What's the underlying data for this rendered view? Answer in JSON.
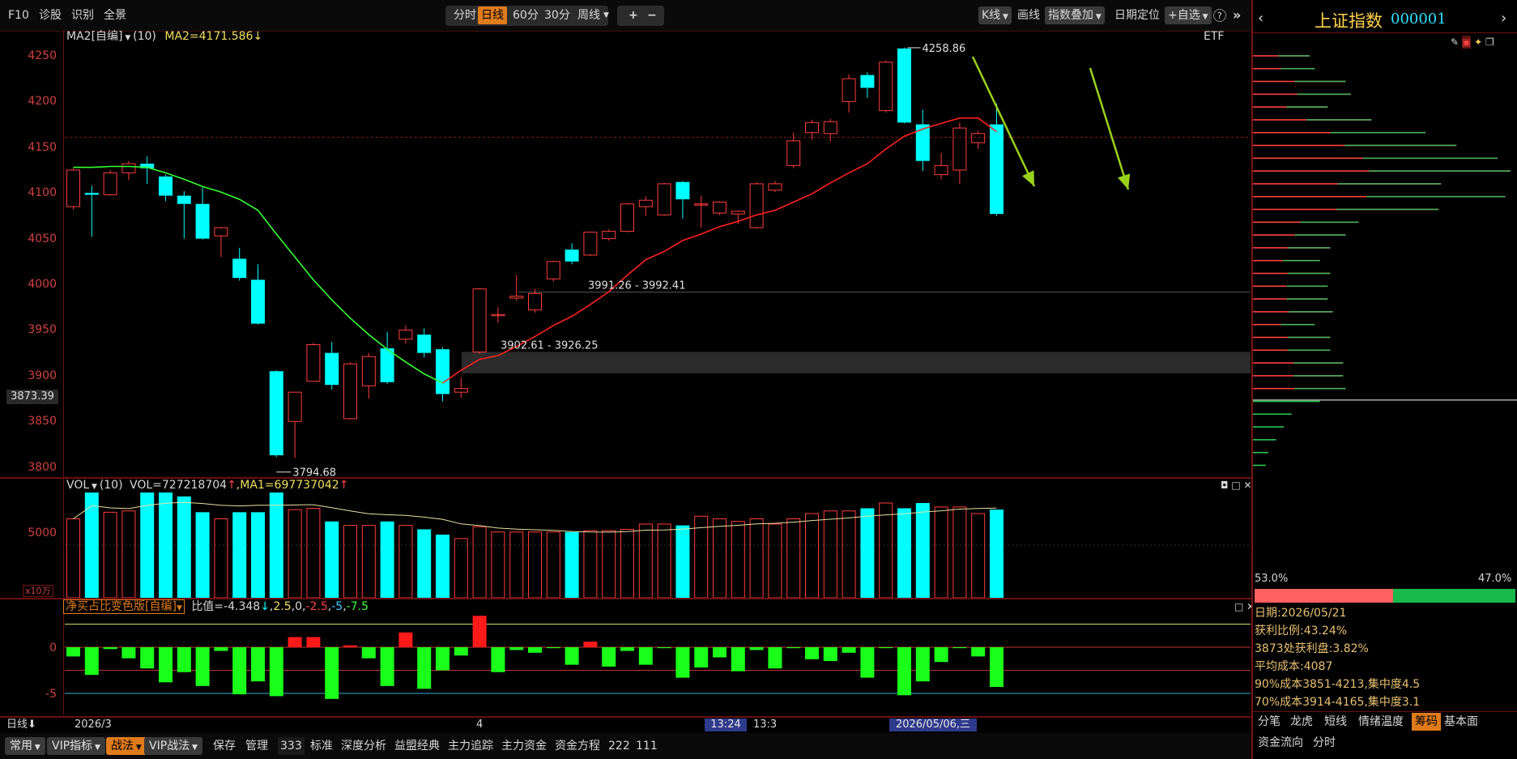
{
  "toolbar": {
    "left": [
      "F10",
      "诊股",
      "识别",
      "全景"
    ],
    "periods": [
      "分时",
      "日线",
      "60分",
      "30分",
      "周线"
    ],
    "period_active": "日线",
    "zoom_in": "+",
    "zoom_out": "−",
    "right": {
      "kline": "K线",
      "draw": "画线",
      "overlay": "指数叠加",
      "date_locate": "日期定位",
      "watchlist": "+自选",
      "help": "?",
      "collapse": "»"
    }
  },
  "main_chart": {
    "indicator_name": "MA2[自编]",
    "param": "(10)",
    "value_text": "MA2=4171.586",
    "etf_label": "ETF",
    "price_labels": [
      "4250",
      "4200",
      "4150",
      "4100",
      "4050",
      "4000",
      "3950",
      "3900",
      "3850",
      "3800"
    ],
    "current_price": "3873.39",
    "annotations": [
      "4258.86",
      "3794.68",
      "3991.26 - 3992.41",
      "3902.61 - 3926.25"
    ]
  },
  "volume_panel": {
    "name": "VOL",
    "param": "(10)",
    "text_vol": "VOL=727218704",
    "text_ma": "MA1=697737042",
    "arrow": "↑",
    "y_label": "5000",
    "unit": "x10万"
  },
  "indicator_panel": {
    "name": "净买占比变色版[自编]",
    "value_label": "比值=-4.348",
    "arrow": "↓",
    "levels": [
      "2.5",
      "0",
      "-2.5",
      "-5",
      "-7.5"
    ],
    "y_labels": [
      "0",
      "-5"
    ]
  },
  "timeline": {
    "label": "日线",
    "d1": "2026/3",
    "d2": "4",
    "cursor_time": "13:24",
    "cursor_time2": "13:3",
    "cursor_date": "2026/05/06,三"
  },
  "bottom_bar": {
    "items": [
      "常用",
      "VIP指标",
      "战法",
      "VIP战法",
      "保存",
      "管理",
      "333",
      "标准",
      "深度分析",
      "益盟经典",
      "主力追踪",
      "主力资金",
      "资金方程",
      "222",
      "111"
    ]
  },
  "right_panel": {
    "title": "上证指数",
    "code": "000001",
    "ratio_left": "53.0%",
    "ratio_right": "47.0%",
    "info": [
      "日期:2026/05/21",
      "获利比例:43.24%",
      "3873处获利盘:3.82%",
      "平均成本:4087",
      "90%成本3851-4213,集中度4.5",
      "70%成本3914-4165,集中度3.1"
    ],
    "tabs": [
      "分笔",
      "龙虎",
      "短线",
      "情绪温度",
      "筹码",
      "基本面"
    ],
    "tabs_active": "筹码",
    "tabs2": [
      "资金流向",
      "分时"
    ]
  },
  "colors": {
    "up": "#ff3c3c",
    "down": "#00ffff",
    "ma": "#ff2020",
    "ma2": "#33ff33",
    "accent": "#e07b1c",
    "title": "#ffd24a"
  },
  "chart_data": {
    "type": "candlestick",
    "y_axis": [
      3790,
      4265
    ],
    "candles": [
      [
        4085,
        4125,
        4127,
        4082
      ],
      [
        4100,
        4098,
        4108,
        4052
      ],
      [
        4098,
        4122,
        4125,
        4097
      ],
      [
        4122,
        4132,
        4135,
        4114
      ],
      [
        4132,
        4127,
        4140,
        4110
      ],
      [
        4118,
        4097,
        4120,
        4091
      ],
      [
        4097,
        4088,
        4102,
        4050
      ],
      [
        4088,
        4050,
        4106,
        4049
      ],
      [
        4053,
        4062,
        4063,
        4030
      ],
      [
        4028,
        4007,
        4040,
        4004
      ],
      [
        4005,
        3957,
        4022,
        3956
      ],
      [
        3905,
        3813,
        3906,
        3811
      ],
      [
        3850,
        3882,
        3882,
        3810
      ],
      [
        3894,
        3934,
        3936,
        3894
      ],
      [
        3925,
        3890,
        3937,
        3885
      ],
      [
        3853,
        3913,
        3915,
        3852
      ],
      [
        3889,
        3921,
        3925,
        3875
      ],
      [
        3930,
        3893,
        3948,
        3891
      ],
      [
        3940,
        3950,
        3955,
        3935
      ],
      [
        3945,
        3925,
        3952,
        3920
      ],
      [
        3929,
        3880,
        3931,
        3872
      ],
      [
        3882,
        3886,
        3898,
        3876
      ],
      [
        3926,
        3995,
        3996,
        3924
      ],
      [
        3967,
        3967,
        3975,
        3958
      ],
      [
        3985,
        3987,
        4010,
        3982
      ],
      [
        3972,
        3990,
        3995,
        3969
      ],
      [
        4006,
        4025,
        4026,
        4003
      ],
      [
        4038,
        4025,
        4045,
        4022
      ],
      [
        4032,
        4057,
        4058,
        4031
      ],
      [
        4050,
        4058,
        4060,
        4048
      ],
      [
        4058,
        4088,
        4089,
        4057
      ],
      [
        4085,
        4092,
        4096,
        4075
      ],
      [
        4076,
        4110,
        4111,
        4075
      ],
      [
        4112,
        4093,
        4113,
        4072
      ],
      [
        4088,
        4088,
        4097,
        4062
      ],
      [
        4078,
        4090,
        4091,
        4076
      ],
      [
        4077,
        4080,
        4081,
        4066
      ],
      [
        4062,
        4110,
        4112,
        4061
      ],
      [
        4103,
        4110,
        4113,
        4101
      ],
      [
        4130,
        4157,
        4166,
        4127
      ],
      [
        4166,
        4177,
        4180,
        4158
      ],
      [
        4165,
        4178,
        4181,
        4156
      ],
      [
        4200,
        4225,
        4230,
        4188
      ],
      [
        4229,
        4215,
        4232,
        4204
      ],
      [
        4190,
        4243,
        4245,
        4188
      ],
      [
        4258,
        4177,
        4259,
        4176
      ],
      [
        4175,
        4135,
        4191,
        4124
      ],
      [
        4120,
        4130,
        4144,
        4115
      ],
      [
        4125,
        4171,
        4177,
        4110
      ],
      [
        4155,
        4165,
        4168,
        4148
      ],
      [
        4175,
        4077,
        4198,
        4075
      ]
    ],
    "ma_green": [
      4128,
      4128,
      4129,
      4129,
      4128,
      4122,
      4115,
      4107,
      4101,
      4093,
      4081,
      4055,
      4030,
      4005,
      3983,
      3963,
      3945,
      3929,
      3915,
      3902,
      3892
    ],
    "ma_red": [
      3892,
      3906,
      3918,
      3922,
      3932,
      3943,
      3955,
      3965,
      3978,
      3992,
      4010,
      4027,
      4036,
      4048,
      4055,
      4063,
      4069,
      4076,
      4081,
      4090,
      4099,
      4111,
      4122,
      4132,
      4148,
      4162,
      4170,
      4176,
      4182,
      4182,
      4167
    ],
    "volume": [
      0.6,
      0.8,
      0.65,
      0.66,
      0.8,
      0.8,
      0.77,
      0.65,
      0.6,
      0.65,
      0.65,
      0.8,
      0.67,
      0.68,
      0.58,
      0.55,
      0.55,
      0.58,
      0.55,
      0.52,
      0.48,
      0.45,
      0.54,
      0.5,
      0.5,
      0.5,
      0.5,
      0.5,
      0.51,
      0.51,
      0.52,
      0.56,
      0.56,
      0.55,
      0.62,
      0.6,
      0.58,
      0.6,
      0.56,
      0.6,
      0.64,
      0.66,
      0.66,
      0.68,
      0.72,
      0.68,
      0.72,
      0.69,
      0.69,
      0.64,
      0.67
    ],
    "net_ratio": [
      -1.0,
      -3.0,
      -0.2,
      -1.2,
      -2.3,
      -3.8,
      -2.7,
      -4.2,
      -0.4,
      -5.1,
      -3.7,
      -5.3,
      1.1,
      1.1,
      -5.6,
      0.2,
      -1.2,
      -4.2,
      1.6,
      -4.5,
      -2.5,
      -0.9,
      3.4,
      -2.7,
      -0.3,
      -0.6,
      -0.1,
      -1.9,
      0.6,
      -2.1,
      -0.4,
      -1.9,
      -0.1,
      -3.3,
      -2.2,
      -1.1,
      -2.6,
      -0.3,
      -2.3,
      -0.1,
      -1.3,
      -1.5,
      -0.6,
      -3.3,
      -0.1,
      -5.2,
      -3.7,
      -1.6,
      -0.1,
      -1.0,
      -4.3
    ],
    "chip_distribution": [
      [
        4250,
        0.22,
        "up"
      ],
      [
        4236,
        0.24,
        "up"
      ],
      [
        4222,
        0.36,
        "up"
      ],
      [
        4208,
        0.38,
        "up"
      ],
      [
        4194,
        0.29,
        "up"
      ],
      [
        4180,
        0.46,
        "up"
      ],
      [
        4166,
        0.67,
        "up"
      ],
      [
        4152,
        0.79,
        "up"
      ],
      [
        4138,
        0.95,
        "up"
      ],
      [
        4124,
        1.0,
        "up"
      ],
      [
        4110,
        0.73,
        "up"
      ],
      [
        4096,
        0.98,
        "up"
      ],
      [
        4082,
        0.72,
        "up"
      ],
      [
        4068,
        0.41,
        "up"
      ],
      [
        4054,
        0.36,
        "up"
      ],
      [
        4040,
        0.3,
        "up"
      ],
      [
        4026,
        0.26,
        "up"
      ],
      [
        4012,
        0.3,
        "up"
      ],
      [
        3998,
        0.29,
        "up"
      ],
      [
        3984,
        0.29,
        "up"
      ],
      [
        3970,
        0.31,
        "up"
      ],
      [
        3956,
        0.24,
        "up"
      ],
      [
        3942,
        0.3,
        "up"
      ],
      [
        3928,
        0.3,
        "up"
      ],
      [
        3914,
        0.35,
        "up"
      ],
      [
        3900,
        0.35,
        "up"
      ],
      [
        3886,
        0.36,
        "up"
      ],
      [
        3872,
        0.26,
        "dn"
      ],
      [
        3858,
        0.15,
        "dn"
      ],
      [
        3844,
        0.12,
        "dn"
      ],
      [
        3830,
        0.09,
        "dn"
      ],
      [
        3816,
        0.06,
        "dn"
      ],
      [
        3802,
        0.05,
        "dn"
      ],
      [
        3788,
        0.04,
        "dn"
      ],
      [
        3774,
        0.03,
        "dn"
      ],
      [
        3760,
        0.02,
        "dn"
      ],
      [
        3746,
        0.02,
        "dn"
      ],
      [
        3732,
        0.01,
        "dn"
      ]
    ]
  }
}
